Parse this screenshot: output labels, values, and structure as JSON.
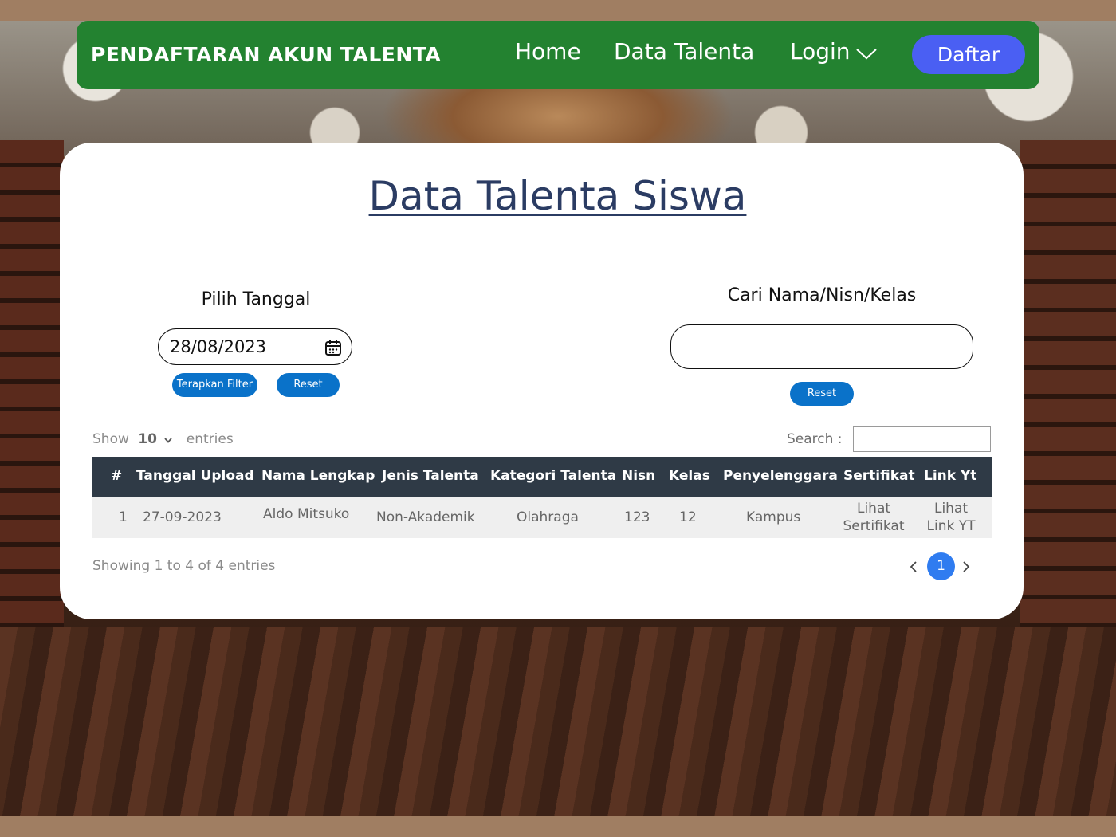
{
  "navbar": {
    "brand": "PENDAFTARAN AKUN TALENTA",
    "home": "Home",
    "data_talenta": "Data Talenta",
    "login": "Login",
    "daftar": "Daftar"
  },
  "main": {
    "title": "Data Talenta Siswa",
    "date_filter": {
      "label": "Pilih Tanggal",
      "value": "28/08/2023",
      "apply_label": "Terapkan Filter",
      "reset_label": "Reset"
    },
    "search_filter": {
      "label": "Cari Nama/Nisn/Kelas",
      "value": "",
      "reset_label": "Reset"
    }
  },
  "table": {
    "show_label": "Show",
    "entries_count": "10",
    "entries_label": "entries",
    "search_label": "Search :",
    "columns": [
      "#",
      "Tanggal Upload",
      "Nama Lengkap",
      "Jenis Talenta",
      "Kategori Talenta",
      "Nisn",
      "Kelas",
      "Penyelenggara",
      "Sertifikat",
      "Link Yt"
    ],
    "rows": [
      {
        "no": "1",
        "tanggal": "27-09-2023",
        "nama": "Aldo Mitsuko",
        "jenis": "Non-Akademik",
        "kategori": "Olahraga",
        "nisn": "123",
        "kelas": "12",
        "penyelenggara": "Kampus",
        "sertifikat_line1": "Lihat",
        "sertifikat_line2": "Sertifikat",
        "link_line1": "Lihat",
        "link_line2": "Link YT"
      }
    ],
    "info": "Showing 1 to 4 of 4 entries",
    "current_page": "1"
  },
  "colors": {
    "navbar": "#238230",
    "daftar_button": "#4a5ff3",
    "title": "#2b3c63",
    "pill_button": "#0a72c9",
    "table_header": "#2f3a46",
    "page_active": "#2f7cf0"
  },
  "icons": [
    "chevron-down-icon",
    "calendar-icon",
    "chevron-left-icon",
    "chevron-right-icon"
  ]
}
